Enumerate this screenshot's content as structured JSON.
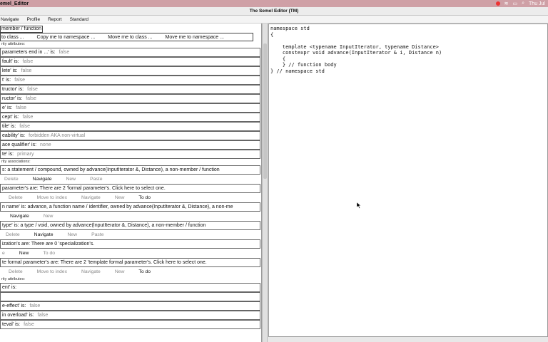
{
  "system_menubar": {
    "app_name": "emel_Editor",
    "right_text": "Thu Jul"
  },
  "window": {
    "title": "The Semel Editor (TM)"
  },
  "app_menu": {
    "items": [
      "Navigate",
      "Profile",
      "Report",
      "Standard"
    ]
  },
  "left": {
    "header_value": "member / function",
    "command_bar": [
      "to class ...",
      "Copy me to namespace ...",
      "Move me to class ...",
      "Move me to namespace ..."
    ],
    "section_attrs": "rity attributes:",
    "attributes": [
      {
        "k": "parameters end in ...' is:",
        "v": "false"
      },
      {
        "k": "fault' is:",
        "v": "false"
      },
      {
        "k": "lete' is:",
        "v": "false"
      },
      {
        "k": "t' is:",
        "v": "false"
      },
      {
        "k": "tructor' is:",
        "v": "false"
      },
      {
        "k": "ructor' is:",
        "v": "false"
      },
      {
        "k": "e' is:",
        "v": "false"
      },
      {
        "k": "cept' is:",
        "v": "false"
      },
      {
        "k": "tile' is:",
        "v": "false"
      },
      {
        "k": "eability' is:",
        "v": "forbidden AKA non-virtual"
      },
      {
        "k": "ace qualifier' is:",
        "v": "none"
      },
      {
        "k": "te' is:",
        "v": "primary"
      }
    ],
    "section_assoc": "rity associations:",
    "assoc": [
      {
        "text": "s: a statement / compound, owned by advance(InputIterator &, Distance), a non-member / function",
        "actions": [
          {
            "t": "Delete",
            "on": false
          },
          {
            "t": "Navigate",
            "on": true
          },
          {
            "t": "New",
            "on": false
          },
          {
            "t": "Paste",
            "on": false
          }
        ]
      },
      {
        "text": "parameter's are:   There are 2 'formal parameter's. Click here to select one.",
        "actions": [
          {
            "t": "Delete",
            "on": false
          },
          {
            "t": "Move to index",
            "on": false
          },
          {
            "t": "Navigate",
            "on": false
          },
          {
            "t": "New",
            "on": false
          },
          {
            "t": "To do",
            "on": true
          }
        ]
      },
      {
        "text": "n name' is: advance, a function name / identifier, owned by advance(InputIterator &, Distance), a non-me",
        "actions": [
          {
            "t": "Navigate",
            "on": true
          },
          {
            "t": "New",
            "on": false
          }
        ]
      },
      {
        "text": "type' is: a type / void, owned by advance(InputIterator &, Distance), a non-member / function",
        "actions": [
          {
            "t": "Delete",
            "on": false
          },
          {
            "t": "Navigate",
            "on": true
          },
          {
            "t": "New",
            "on": false
          },
          {
            "t": "Paste",
            "on": false
          }
        ]
      },
      {
        "text": "ization's are:   There are 0 'specialization's.",
        "actions": [
          {
            "t": "e",
            "on": false
          },
          {
            "t": "New",
            "on": true
          },
          {
            "t": "To do",
            "on": false
          }
        ]
      },
      {
        "text": "te formal parameter's are:   There are 2 'template formal parameter's. Click here to select one.",
        "actions": [
          {
            "t": "Delete",
            "on": false
          },
          {
            "t": "Move to index",
            "on": false
          },
          {
            "t": "Navigate",
            "on": false
          },
          {
            "t": "New",
            "on": false
          },
          {
            "t": "To do",
            "on": true
          }
        ]
      }
    ],
    "section_attrs2": "rity attributes:",
    "attributes2": [
      {
        "k": "ent' is:",
        "v": ""
      },
      {
        "k": "",
        "v": ""
      },
      {
        "k": "e-effect' is:",
        "v": "false"
      },
      {
        "k": "in overload' is:",
        "v": "false"
      },
      {
        "k": "teval' is:",
        "v": "false"
      }
    ]
  },
  "code": "namespace std\n{\n\n    template <typename InputIterator, typename Distance>\n    constexpr void advance(InputIterator & i, Distance n)\n    {\n    } // function body\n} // namespace std"
}
